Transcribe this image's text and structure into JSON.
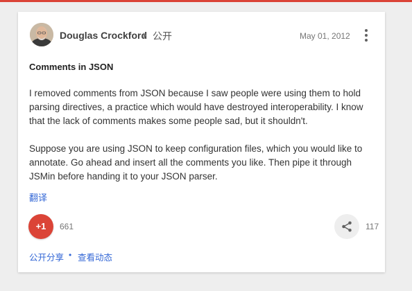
{
  "post": {
    "author": "Douglas Crockford",
    "visibility": "公开",
    "date": "May 01, 2012",
    "title": "Comments in JSON",
    "paragraphs": [
      "I removed comments from JSON because I saw people were using them to hold parsing directives, a practice which would have destroyed interoperability.  I know that the lack of comments makes some people sad, but it shouldn't.",
      "Suppose you are using JSON to keep configuration files, which you would like to annotate. Go ahead and insert all the comments you like. Then pipe it through JSMin before handing it to your JSON parser."
    ],
    "translate_label": "翻译"
  },
  "actions": {
    "plus_one_label": "+1",
    "plus_one_count": "661",
    "share_count": "117"
  },
  "footer": {
    "public_share_label": "公开分享",
    "separator": "•",
    "view_activity_label": "查看动态"
  },
  "colors": {
    "accent_red": "#db4437",
    "link_blue": "#3367d6",
    "background": "#eeeeee"
  },
  "icons": {
    "more": "more-vertical-icon",
    "share": "share-icon",
    "caret": "caret-right-icon"
  }
}
